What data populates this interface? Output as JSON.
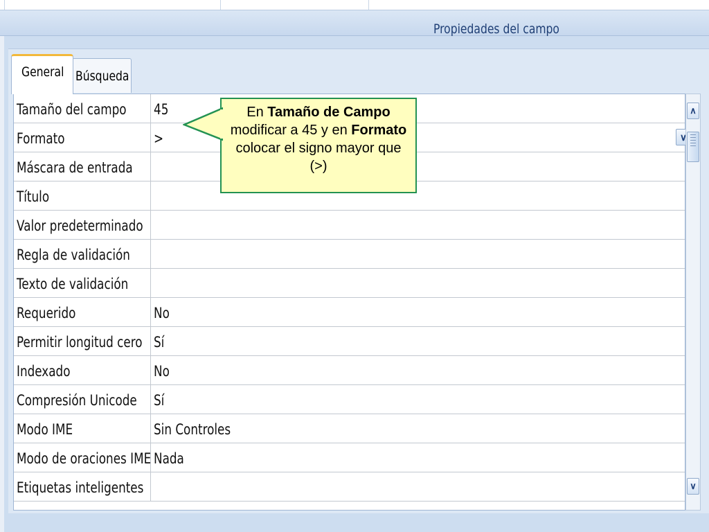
{
  "header": {
    "title": "Propiedades del campo"
  },
  "tabs": [
    {
      "label": "General",
      "active": true
    },
    {
      "label": "Búsqueda",
      "active": false
    }
  ],
  "properties": [
    {
      "label": "Tamaño del campo",
      "value": "45"
    },
    {
      "label": "Formato",
      "value": ">"
    },
    {
      "label": "Máscara de entrada",
      "value": ""
    },
    {
      "label": "Título",
      "value": ""
    },
    {
      "label": "Valor predeterminado",
      "value": ""
    },
    {
      "label": "Regla de validación",
      "value": ""
    },
    {
      "label": "Texto de validación",
      "value": ""
    },
    {
      "label": "Requerido",
      "value": "No"
    },
    {
      "label": "Permitir longitud cero",
      "value": "Sí"
    },
    {
      "label": "Indexado",
      "value": "No"
    },
    {
      "label": "Compresión Unicode",
      "value": "Sí"
    },
    {
      "label": "Modo IME",
      "value": "Sin Controles"
    },
    {
      "label": "Modo de oraciones IME",
      "value": "Nada"
    },
    {
      "label": "Etiquetas inteligentes",
      "value": ""
    }
  ],
  "callout": {
    "t1": "En ",
    "b1": "Tamaño de Campo",
    "t2": " modificar a 45 y en ",
    "b2": "Formato",
    "t3": " colocar el signo mayor que (>)"
  },
  "icons": {
    "dropdown": "chevron-down-icon",
    "scroll_up": "chevron-up-icon",
    "scroll_down": "chevron-down-icon"
  },
  "colors": {
    "accent_tab": "#f2b83b",
    "callout_bg": "#fffebf",
    "callout_border": "#239252",
    "header_text": "#1f3f75"
  }
}
